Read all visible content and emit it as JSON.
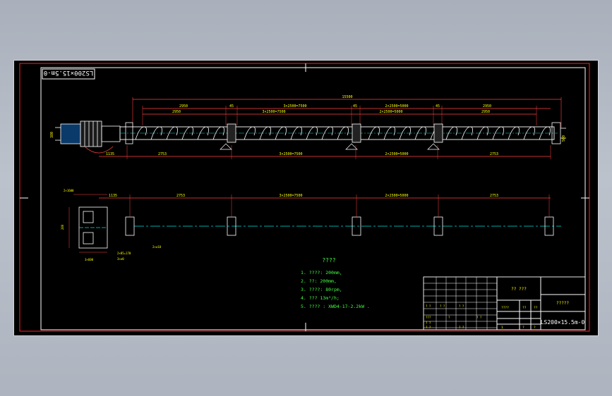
{
  "drawing": {
    "title_box_text": "LS200×15.5m-0",
    "overall_length_label": "15500",
    "top_dims": [
      "2950",
      "45",
      "3×2500=7500",
      "45",
      "2×2500=5000",
      "45",
      "2950"
    ],
    "top_sub_dims": [
      "2950",
      "3×2500=7500",
      "2×2500=5000",
      "2950"
    ],
    "lower_dims": [
      "1135",
      "2753",
      "3×2500=7500",
      "2×2500=5000",
      "2753"
    ],
    "plan_dims": [
      "1135",
      "2753",
      "3×2500=7500",
      "2×2500=5000",
      "2753"
    ],
    "side_label_left": "380",
    "side_label_right": "500",
    "section_labels": [
      "2×1600",
      "280",
      "2×85=170",
      "3×600",
      "2×∅18",
      "3×∅0"
    ],
    "tech_title": "????",
    "tech_notes": [
      "1.  ????: 200mm,",
      "2.  ??: 200mm,",
      "3.  ????: 80rpm,",
      "4.  ???  13m³/h;",
      "5.  ???? : XWD4-17-2.2kW ."
    ]
  },
  "title_block": {
    "header_cells": [
      "?? ???",
      "?????"
    ],
    "code": "LS200×15.5m-0",
    "row_cells": [
      "????",
      "??",
      "??",
      "1",
      "?",
      "?"
    ],
    "left_cells": [
      "? ?",
      "? ?",
      "? ?",
      "???",
      "?",
      "? ?",
      "? ?",
      "? ?",
      "? ?"
    ]
  },
  "colors": {
    "frame": "#ff2020",
    "dim": "#ff4040",
    "shaft": "#00e0e0",
    "part": "#ffffff",
    "note": "#40ff40",
    "text": "#ffff00"
  }
}
